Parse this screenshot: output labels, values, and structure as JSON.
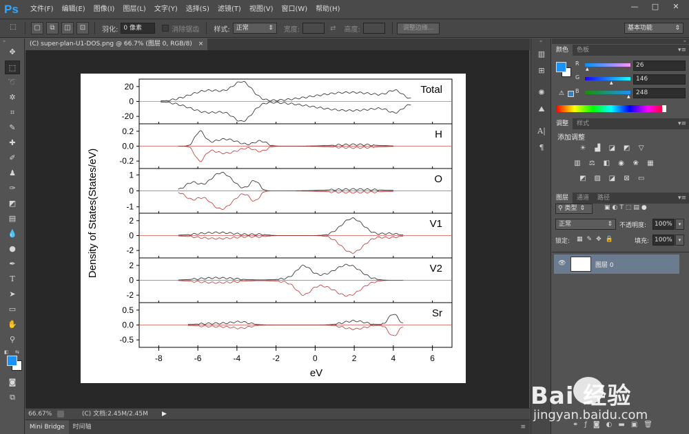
{
  "app": {
    "logo": "Ps",
    "menus": [
      "文件(F)",
      "编辑(E)",
      "图像(I)",
      "图层(L)",
      "文字(Y)",
      "选择(S)",
      "滤镜(T)",
      "视图(V)",
      "窗口(W)",
      "帮助(H)"
    ],
    "window_controls": {
      "minimize": "—",
      "restore": "□",
      "close": "✕"
    }
  },
  "options_bar": {
    "feather_label": "羽化:",
    "feather_value": "0 像素",
    "antialias_label": "消除锯齿",
    "style_label": "样式:",
    "style_value": "正常",
    "width_label": "宽度:",
    "height_label": "高度:",
    "refine_edge_label": "调整边缘...",
    "workspace_value": "基本功能"
  },
  "document": {
    "tab_title": "(C) super-plan-U1-DOS.png @ 66.7% (图层 0, RGB/8)",
    "tab_close": "×",
    "zoom": "66.67%",
    "doc_size": "(C) 文档:2.45M/2.45M"
  },
  "bottom_tabs": [
    "Mini Bridge",
    "时间轴"
  ],
  "color_panel": {
    "tabs": [
      "颜色",
      "色板"
    ],
    "r_label": "R",
    "r_value": "26",
    "g_label": "G",
    "g_value": "146",
    "b_label": "B",
    "b_value": "248",
    "foreground_color": "#1a92f8"
  },
  "adjust_panel": {
    "tabs": [
      "调整",
      "样式"
    ],
    "add_label": "添加调整"
  },
  "layers_panel": {
    "tabs": [
      "图层",
      "通道",
      "路径"
    ],
    "kind_filter": "类型",
    "blend_mode": "正常",
    "opacity_label": "不透明度:",
    "opacity_value": "100%",
    "lock_label": "锁定:",
    "fill_label": "填充:",
    "fill_value": "100%",
    "layer_name": "图层 0"
  },
  "watermark": {
    "brand": "Bai 经验",
    "url": "jingyan.baidu.com"
  },
  "chart_data": {
    "type": "line",
    "ylabel": "Density of States(States/eV)",
    "xlabel": "eV",
    "xlim": [
      -9,
      7
    ],
    "x_ticks": [
      -8,
      -6,
      -4,
      -2,
      0,
      2,
      4,
      6
    ],
    "panels": [
      {
        "name": "Total",
        "ylim": [
          -30,
          30
        ],
        "y_ticks": [
          20,
          0,
          -20
        ]
      },
      {
        "name": "H",
        "ylim": [
          -0.3,
          0.3
        ],
        "y_ticks": [
          0.2,
          0.0,
          -0.2
        ]
      },
      {
        "name": "O",
        "ylim": [
          -1.4,
          1.4
        ],
        "y_ticks": [
          1,
          0,
          -1
        ]
      },
      {
        "name": "V1",
        "ylim": [
          -3,
          3
        ],
        "y_ticks": [
          2,
          0,
          -2
        ]
      },
      {
        "name": "V2",
        "ylim": [
          -3,
          3
        ],
        "y_ticks": [
          2,
          0,
          -2
        ]
      },
      {
        "name": "Sr",
        "ylim": [
          -0.75,
          0.75
        ],
        "y_ticks": [
          0.5,
          0.0,
          -0.5
        ]
      }
    ]
  }
}
